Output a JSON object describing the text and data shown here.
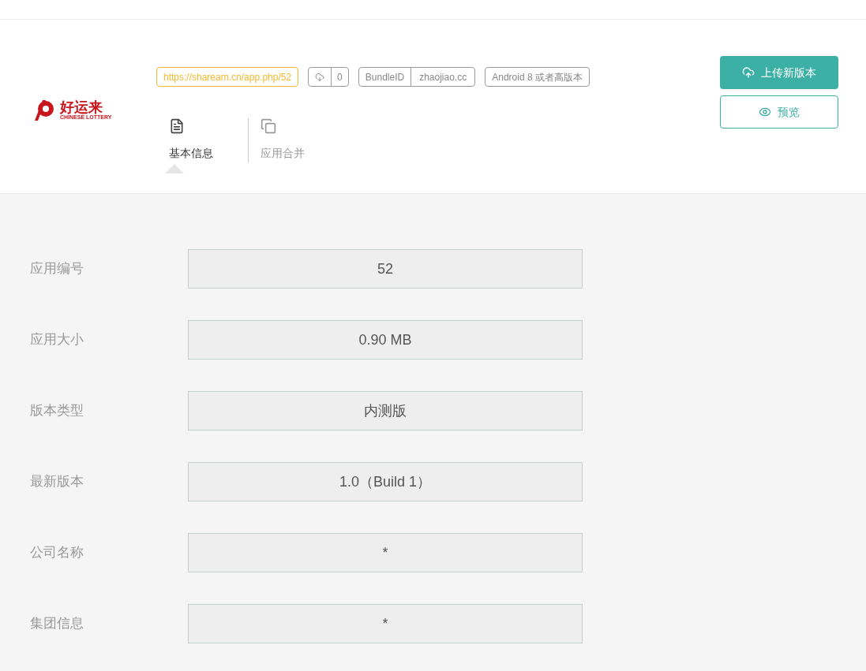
{
  "logo": {
    "name": "好运来",
    "subtitle": "CHINESE LOTTERY"
  },
  "link": "https://shaream.cn/app.php/52",
  "downloads": "0",
  "bundle": {
    "label": "BundleID",
    "value": "zhaojiao.cc"
  },
  "requirement": "Android 8 或者高版本",
  "tabs": [
    {
      "label": "基本信息",
      "kind": "info",
      "selected": true
    },
    {
      "label": "应用合并",
      "kind": "merge",
      "selected": false
    }
  ],
  "buttons": [
    {
      "label": "上传新版本",
      "kind": "upload"
    },
    {
      "label": "预览",
      "kind": "preview"
    }
  ],
  "fields": [
    {
      "label": "应用编号",
      "value": "52"
    },
    {
      "label": "应用大小",
      "value": "0.90 MB"
    },
    {
      "label": "版本类型",
      "value": "内测版"
    },
    {
      "label": "最新版本",
      "value": "1.0（Build 1）"
    },
    {
      "label": "公司名称",
      "value": "*"
    },
    {
      "label": "集团信息",
      "value": "*"
    }
  ]
}
